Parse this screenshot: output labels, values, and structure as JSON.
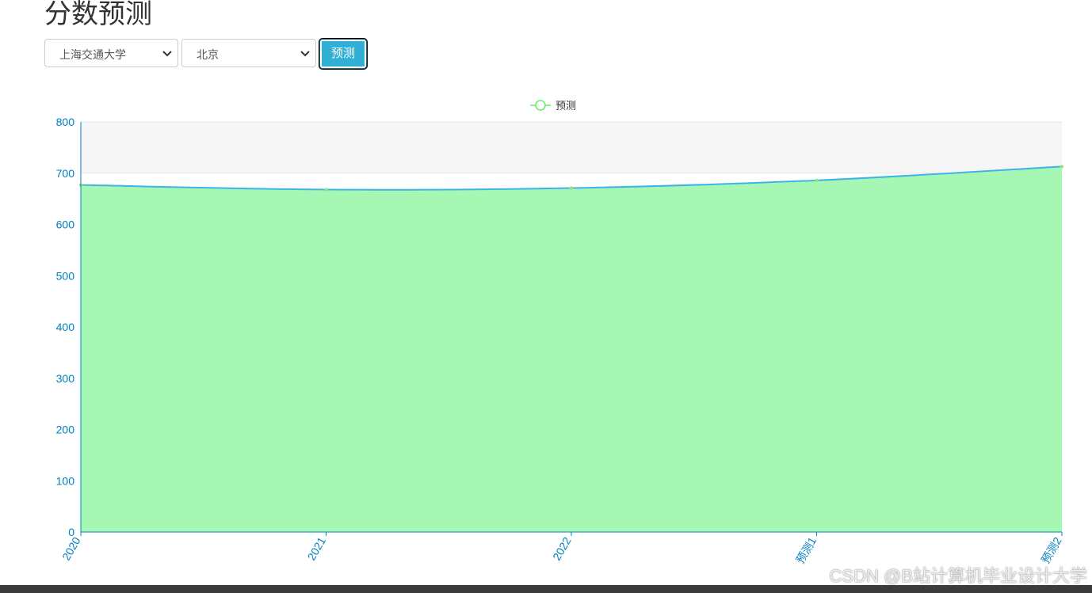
{
  "page": {
    "title": "分数预测"
  },
  "form": {
    "school_value": "上海交通大学",
    "region_value": "北京",
    "predict_label": "预测"
  },
  "chart_data": {
    "type": "area",
    "categories": [
      "2020",
      "2021",
      "2022",
      "预测1",
      "预测2"
    ],
    "series": [
      {
        "name": "预测",
        "values": [
          677,
          668,
          671,
          686,
          713
        ]
      }
    ],
    "ylim": [
      0,
      800
    ],
    "yticks": [
      0,
      100,
      200,
      300,
      400,
      500,
      600,
      700,
      800
    ],
    "legend_position": "top-center",
    "grid": true,
    "colors": {
      "line": "#3cb4e8",
      "area": "#a2f7b0",
      "axis": "#0080c0",
      "legend_symbol": "#66ee66",
      "split_area": "#f6f6f6"
    }
  },
  "watermark": "CSDN @B站计算机毕业设计大学"
}
